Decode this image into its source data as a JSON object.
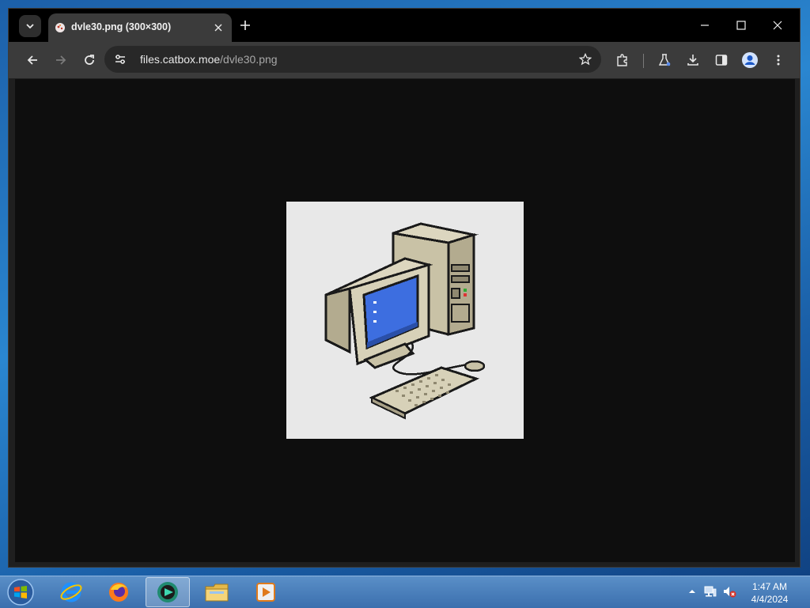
{
  "browser": {
    "tab": {
      "title": "dvle30.png (300×300)"
    },
    "address": {
      "host": "files.catbox.moe",
      "path": "/dvle30.png"
    },
    "colors": {
      "titlebar": "#000000",
      "toolbar": "#3b3b3b",
      "viewport": "#0e0e0e"
    }
  },
  "image": {
    "description_icon": "retro-computer-pixel-art",
    "background": "#e8e8e8"
  },
  "taskbar": {
    "items": [
      {
        "name": "internet-explorer-icon"
      },
      {
        "name": "firefox-icon"
      },
      {
        "name": "chrome-browser-icon"
      },
      {
        "name": "file-explorer-icon"
      },
      {
        "name": "media-player-icon"
      }
    ],
    "clock": {
      "time": "1:47 AM",
      "date": "4/4/2024"
    }
  }
}
